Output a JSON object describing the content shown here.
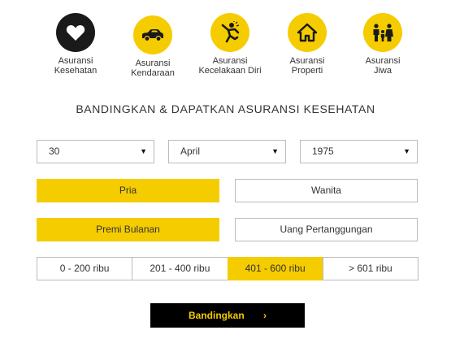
{
  "categories": [
    {
      "icon": "heart-icon",
      "line1": "Asuransi",
      "line2": "Kesehatan",
      "active": true
    },
    {
      "icon": "car-icon",
      "line1": "Asuransi",
      "line2": "Kendaraan",
      "active": false
    },
    {
      "icon": "falling-person-icon",
      "line1": "Asuransi",
      "line2": "Kecelakaan Diri",
      "active": false
    },
    {
      "icon": "house-icon",
      "line1": "Asuransi",
      "line2": "Properti",
      "active": false
    },
    {
      "icon": "family-icon",
      "line1": "Asuransi",
      "line2": "Jiwa",
      "active": false
    }
  ],
  "title": "BANDINGKAN & DAPATKAN ASURANSI KESEHATAN",
  "birthdate": {
    "day": "30",
    "month": "April",
    "year": "1975"
  },
  "gender": {
    "pria": "Pria",
    "wanita": "Wanita",
    "selected": "pria"
  },
  "coverage_type": {
    "premi": "Premi Bulanan",
    "uang": "Uang Pertanggungan",
    "selected": "premi"
  },
  "ranges": [
    "0 - 200 ribu",
    "201 - 400 ribu",
    "401 - 600 ribu",
    "> 601 ribu"
  ],
  "range_selected": 2,
  "compare_label": "Bandingkan",
  "colors": {
    "accent": "#f5cc00",
    "dark": "#1a1a1a",
    "border": "#bbbbbb"
  }
}
